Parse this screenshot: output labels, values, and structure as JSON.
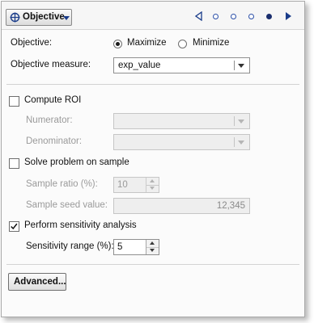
{
  "header": {
    "menu_label": "Objective",
    "menu_icon": "target-icon",
    "pager": {
      "page_count": 5,
      "current_page": 5
    }
  },
  "objective": {
    "label": "Objective:",
    "options": [
      {
        "label": "Maximize",
        "selected": true
      },
      {
        "label": "Minimize",
        "selected": false
      }
    ]
  },
  "objective_measure": {
    "label": "Objective measure:",
    "value": "exp_value"
  },
  "compute_roi": {
    "label": "Compute ROI",
    "checked": false,
    "numerator_label": "Numerator:",
    "numerator_value": "",
    "denominator_label": "Denominator:",
    "denominator_value": ""
  },
  "solve_sample": {
    "label": "Solve problem on sample",
    "checked": false,
    "ratio_label": "Sample ratio (%):",
    "ratio_value": "10",
    "seed_label": "Sample seed value:",
    "seed_value": "12,345"
  },
  "sensitivity": {
    "label": "Perform sensitivity analysis",
    "checked": true,
    "range_label": "Sensitivity range (%):",
    "range_value": "5"
  },
  "advanced_button": "Advanced...",
  "colors": {
    "accent": "#1b2f6e",
    "disabled_text": "#9a9a9a",
    "panel_bg": "#fbfbfb"
  }
}
